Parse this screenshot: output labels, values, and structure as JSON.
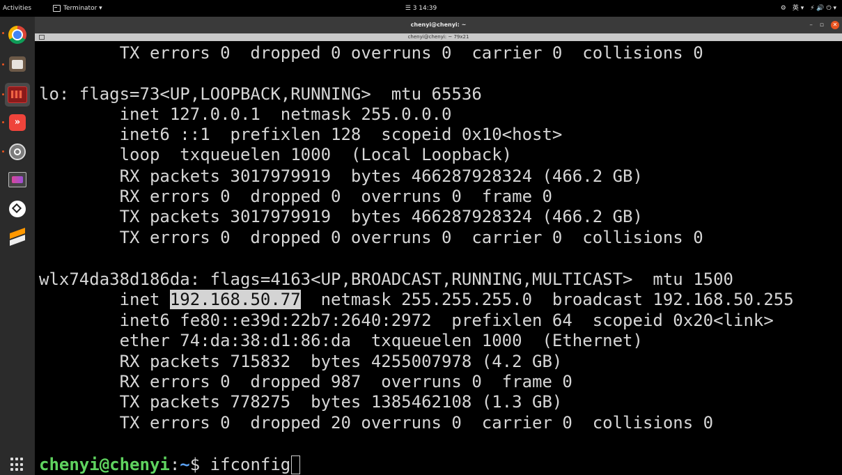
{
  "topbar": {
    "activities": "Activities",
    "app_menu": "Terminator ▾",
    "clock": "☰ 3  14:39",
    "tray": [
      "⚙",
      "英 ▾",
      "⚡ 🔊 ⏻ ▾"
    ]
  },
  "dock": {
    "items": [
      {
        "name": "chrome",
        "running": true
      },
      {
        "name": "files",
        "running": true
      },
      {
        "name": "terminator",
        "running": true,
        "active": true
      },
      {
        "name": "anydesk",
        "running": true
      },
      {
        "name": "settings",
        "running": true
      },
      {
        "name": "video",
        "running": false
      },
      {
        "name": "unity",
        "running": false
      },
      {
        "name": "sublime",
        "running": false
      }
    ]
  },
  "window": {
    "title": "chenyi@chenyi: ~",
    "controls": {
      "minimize": "–",
      "maximize": "▫",
      "close": "✕"
    },
    "terminal_title": "chenyi@chenyi: ~ 79x21"
  },
  "terminal": {
    "lines": [
      "        TX errors 0  dropped 0 overruns 0  carrier 0  collisions 0",
      "",
      "lo: flags=73<UP,LOOPBACK,RUNNING>  mtu 65536",
      "        inet 127.0.0.1  netmask 255.0.0.0",
      "        inet6 ::1  prefixlen 128  scopeid 0x10<host>",
      "        loop  txqueuelen 1000  (Local Loopback)",
      "        RX packets 3017979919  bytes 466287928324 (466.2 GB)",
      "        RX errors 0  dropped 0  overruns 0  frame 0",
      "        TX packets 3017979919  bytes 466287928324 (466.2 GB)",
      "        TX errors 0  dropped 0 overruns 0  carrier 0  collisions 0",
      "",
      "wlx74da38d186da: flags=4163<UP,BROADCAST,RUNNING,MULTICAST>  mtu 1500",
      "",
      "        inet6 fe80::e39d:22b7:2640:2972  prefixlen 64  scopeid 0x20<link>",
      "        ether 74:da:38:d1:86:da  txqueuelen 1000  (Ethernet)",
      "        RX packets 715832  bytes 4255007978 (4.2 GB)",
      "        RX errors 0  dropped 987  overruns 0  frame 0",
      "        TX packets 778275  bytes 1385462108 (1.3 GB)",
      "        TX errors 0  dropped 20 overruns 0  carrier 0  collisions 0",
      ""
    ],
    "inet_line": {
      "prefix": "        inet ",
      "selected_ip": "192.168.50.77",
      "suffix": "  netmask 255.255.255.0  broadcast 192.168.50.255"
    },
    "prompt": {
      "user_host": "chenyi@chenyi",
      "sep": ":",
      "path": "~",
      "symbol": "$ ",
      "command": "ifconfig"
    }
  },
  "colors": {
    "prompt_user": "#5fd35f",
    "prompt_path": "#5aa0f0",
    "text": "#d6d6d6",
    "selection": "#d4d4d4",
    "dock": "#2b2b2b",
    "accent": "#e95420"
  }
}
